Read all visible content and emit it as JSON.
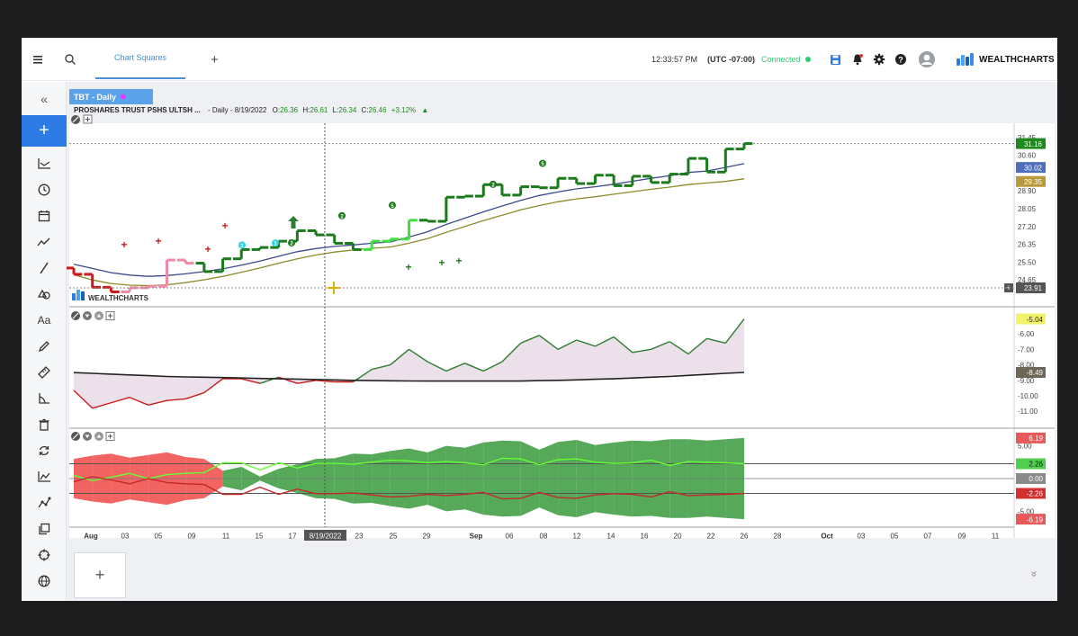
{
  "header": {
    "tab_label": "Chart Squares",
    "time": "12:33:57 PM",
    "timezone": "(UTC -07:00)",
    "status": "Connected",
    "status_color": "#2ecc71",
    "brand": "WEALTHCHARTS",
    "icons": [
      "menu-icon",
      "search-icon",
      "add-tab-icon",
      "save-icon",
      "alert-bell-icon",
      "settings-gear-icon",
      "help-icon",
      "user-avatar-icon"
    ]
  },
  "sidebar": {
    "icons": [
      "collapse-icon",
      "add-icon",
      "chart-type-icon",
      "clock-icon",
      "calendar-icon",
      "trend-icon",
      "line-draw-icon",
      "shapes-icon",
      "text-icon",
      "pencil-icon",
      "ruler-icon",
      "angle-icon",
      "trash-icon",
      "refresh-icon",
      "indicator-icon",
      "pattern-icon",
      "layers-icon",
      "crosshair-icon",
      "globe-icon"
    ],
    "text_tool_label": "Aa"
  },
  "chart": {
    "symbol_tab": "TBT - Daily",
    "symbol_tab_dot_color": "#e040fb",
    "description": "PROSHARES TRUST PSHS ULTSH ...",
    "interval": "- Daily - 8/19/2022",
    "o_label": "O:",
    "o": "26.36",
    "h_label": "H:",
    "h": "26.61",
    "l_label": "L:",
    "l": "26.34",
    "c_label": "C:",
    "c": "26.46",
    "change": "+3.12%",
    "change_arrow": "▲",
    "watermark": "WEALTHCHARTS",
    "crosshair_date": "8/19/2022"
  },
  "chart_data": [
    {
      "type": "line",
      "title": "",
      "panel": "price",
      "y_ticks": [
        "31.45",
        "30.60",
        "28.90",
        "28.05",
        "27.20",
        "26.35",
        "25.50",
        "24.65"
      ],
      "ylim": [
        23.8,
        31.7
      ],
      "price_tags": [
        {
          "value": "31.16",
          "color": "#1e8a1e"
        },
        {
          "value": "30.02",
          "color": "#4f6fbd"
        },
        {
          "value": "29.35",
          "color": "#b89a3a"
        },
        {
          "value": "23.91",
          "color": "#555555"
        }
      ],
      "series": [
        {
          "values": [
            24.92,
            24.3,
            24.08,
            24.28,
            24.35,
            25.6,
            25.45,
            25.05,
            25.66,
            26.1,
            26.2,
            26.5,
            27.0,
            26.8,
            26.4,
            26.1,
            26.5,
            26.6,
            27.5,
            27.45,
            28.6,
            28.65,
            29.2,
            28.7,
            29.1,
            29.05,
            29.5,
            29.25,
            29.65,
            29.15,
            29.6,
            29.3,
            29.7,
            30.45,
            29.8,
            30.9,
            31.16
          ]
        },
        {
          "values": [
            25.4,
            25.2,
            25.0,
            24.88,
            24.82,
            24.86,
            24.94,
            25.05,
            25.18,
            25.36,
            25.55,
            25.78,
            26.0,
            26.15,
            26.25,
            26.32,
            26.4,
            26.46,
            26.7,
            26.95,
            27.3,
            27.6,
            27.9,
            28.18,
            28.45,
            28.68,
            28.85,
            29.0,
            29.1,
            29.22,
            29.36,
            29.5,
            29.62,
            29.78,
            29.85,
            30.02,
            30.2
          ]
        },
        {
          "values": [
            24.9,
            24.65,
            24.48,
            24.4,
            24.38,
            24.42,
            24.52,
            24.66,
            24.82,
            25.02,
            25.22,
            25.45,
            25.66,
            25.84,
            25.98,
            26.08,
            26.16,
            26.22,
            26.4,
            26.62,
            26.92,
            27.2,
            27.48,
            27.74,
            28.0,
            28.2,
            28.38,
            28.52,
            28.62,
            28.74,
            28.86,
            28.98,
            29.08,
            29.2,
            29.28,
            29.35,
            29.48
          ]
        }
      ],
      "markers": [
        {
          "value": 25.8,
          "text": "1",
          "color": "#2dd4e8"
        },
        {
          "value": 25.9,
          "text": "1",
          "color": "#2dd4e8"
        },
        {
          "value": 25.9,
          "text": "2",
          "color": "#1b7a1b"
        },
        {
          "value": 27.2,
          "text": "2",
          "color": "#1b7a1b"
        },
        {
          "value": 27.7,
          "text": "5",
          "color": "#1b7a1b"
        },
        {
          "value": 28.7,
          "text": "2",
          "color": "#1b7a1b"
        },
        {
          "value": 29.7,
          "text": "5",
          "color": "#1b7a1b"
        }
      ]
    },
    {
      "type": "line",
      "title": "",
      "panel": "oscillator",
      "y_ticks": [
        "-6.00",
        "-7.00",
        "-8.00",
        "-9.00",
        "-10.00",
        "-11.00"
      ],
      "ylim": [
        -11.8,
        -4.6
      ],
      "value_tags": [
        {
          "value": "-5.04",
          "color": "#f3f36b"
        },
        {
          "value": "-8.49",
          "color": "#6e6658"
        }
      ],
      "series": [
        {
          "values": [
            -9.65,
            -10.8,
            -10.45,
            -10.1,
            -10.6,
            -10.3,
            -10.2,
            -9.8,
            -8.9,
            -8.9,
            -9.2,
            -8.8,
            -9.2,
            -9.0,
            -9.1,
            -9.1,
            -8.3,
            -8.0,
            -7.0,
            -7.8,
            -8.4,
            -7.9,
            -8.4,
            -7.8,
            -6.6,
            -6.1,
            -7.0,
            -6.4,
            -6.8,
            -6.2,
            -7.2,
            -7.0,
            -6.5,
            -7.3,
            -6.3,
            -6.6,
            -5.04
          ]
        },
        {
          "values": [
            -8.5,
            -8.55,
            -8.6,
            -8.65,
            -8.7,
            -8.75,
            -8.78,
            -8.8,
            -8.82,
            -8.85,
            -8.88,
            -8.9,
            -8.92,
            -8.95,
            -8.97,
            -9.0,
            -9.02,
            -9.03,
            -9.04,
            -9.05,
            -9.05,
            -9.05,
            -9.05,
            -9.05,
            -9.05,
            -9.02,
            -9.0,
            -8.97,
            -8.93,
            -8.9,
            -8.85,
            -8.8,
            -8.75,
            -8.68,
            -8.62,
            -8.55,
            -8.49
          ]
        }
      ]
    },
    {
      "type": "area",
      "title": "",
      "panel": "bands",
      "y_ticks": [
        "5.00",
        "0.00",
        "-5.00"
      ],
      "ylim": [
        -7.0,
        7.0
      ],
      "value_tags": [
        {
          "value": "6.19",
          "color": "#e85a5a"
        },
        {
          "value": "2.26",
          "color": "#4fcf4f"
        },
        {
          "value": "0.00",
          "color": "#8a8a8a"
        },
        {
          "value": "-2.26",
          "color": "#d03030"
        },
        {
          "value": "-6.19",
          "color": "#e85a5a"
        }
      ],
      "series": [
        {
          "values": [
            3.0,
            3.5,
            3.8,
            3.2,
            3.6,
            4.0,
            3.3,
            3.0,
            1.2,
            1.8,
            0.3,
            1.5,
            2.2,
            3.0,
            3.1,
            3.8,
            3.7,
            4.2,
            4.6,
            4.0,
            5.0,
            4.7,
            5.5,
            5.8,
            5.7,
            4.4,
            5.6,
            5.9,
            5.1,
            5.5,
            5.8,
            5.7,
            6.0,
            6.0,
            5.8,
            6.0,
            6.19
          ]
        },
        {
          "values": [
            0.5,
            -0.3,
            0.2,
            0.8,
            0.0,
            0.6,
            0.8,
            0.9,
            2.4,
            2.4,
            1.3,
            2.4,
            1.6,
            2.3,
            2.3,
            2.2,
            2.5,
            2.8,
            2.7,
            2.4,
            2.6,
            2.4,
            2.1,
            3.1,
            3.0,
            2.1,
            2.9,
            3.0,
            2.5,
            2.3,
            2.4,
            2.8,
            2.0,
            2.6,
            2.5,
            2.4,
            2.26
          ]
        }
      ]
    }
  ],
  "x_axis": {
    "labels": [
      "Aug",
      "03",
      "05",
      "09",
      "11",
      "15",
      "17",
      "23",
      "25",
      "29",
      "Sep",
      "06",
      "08",
      "12",
      "14",
      "16",
      "20",
      "22",
      "26",
      "28",
      "Oct",
      "03",
      "05",
      "07",
      "09",
      "11"
    ]
  }
}
